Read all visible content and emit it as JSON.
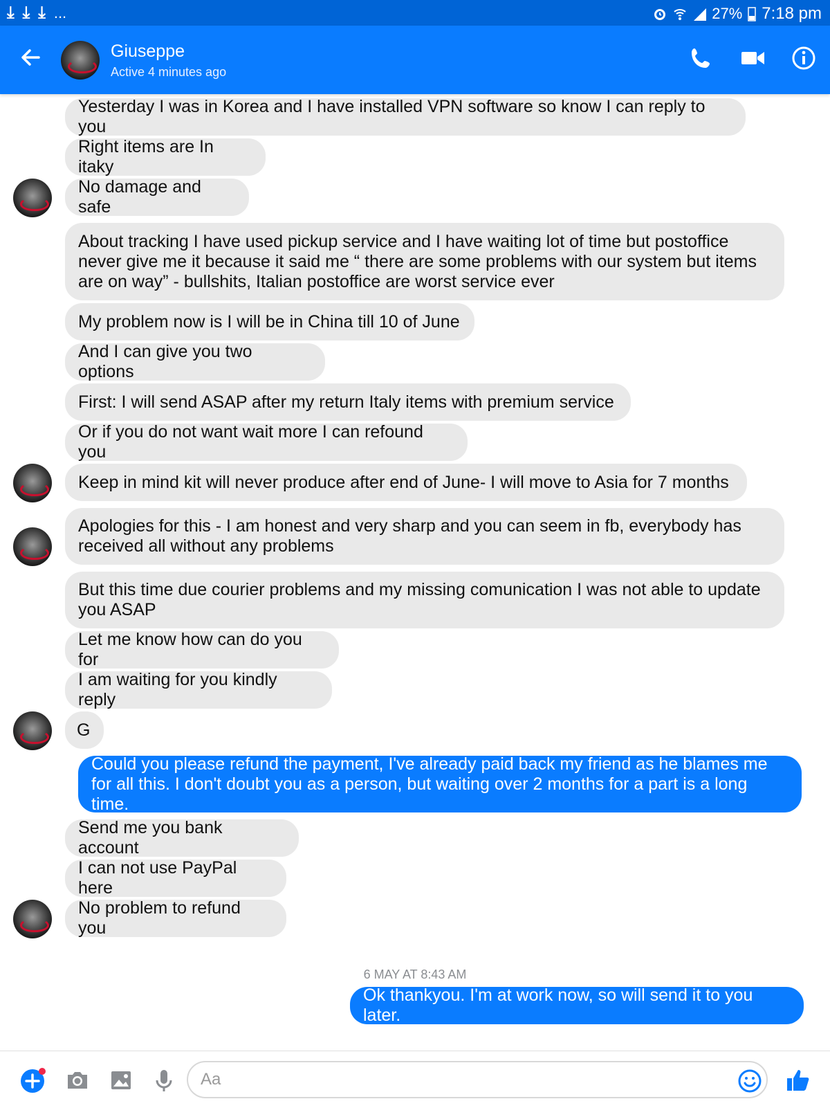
{
  "status_bar": {
    "download_icons": [
      "download-icon",
      "download-icon",
      "download-icon"
    ],
    "more": "...",
    "battery": "27%",
    "time": "7:18 pm"
  },
  "header": {
    "contact_name": "Giuseppe",
    "contact_status": "Active 4 minutes ago"
  },
  "messages": {
    "m1": "Yesterday I was in Korea and I have installed VPN software so know I can reply to you",
    "m2": "Right items are In itaky",
    "m3": "No damage and safe",
    "m4": "About tracking I have used pickup service and I have waiting lot of time but postoffice never give me it because it said me “ there are some problems with our system but items are on way” - bullshits, Italian postoffice are worst service ever",
    "m5": "My problem now is I will be in China till 10 of June",
    "m6": "And I can give you two options",
    "m7": "First: I will send ASAP after my return Italy items with premium service",
    "m8": "Or if you do not want wait more I can refound you",
    "m9": "Keep in mind kit will never produce after end of June- I will move to Asia for 7 months",
    "m10": "Apologies for this - I am honest and very sharp and you can seem in fb, everybody has received all without any problems",
    "m11": "But this time due courier problems and my missing comunication I was not able to update you ASAP",
    "m12": "Let me know how can do you for",
    "m13": "I am waiting for you kindly reply",
    "m14": "G",
    "m15": "Could you please refund the payment, I've already paid back my friend as he blames me for all this. I don't doubt you as a person, but waiting over 2 months for a part is a long time.",
    "m16": "Send me you bank account",
    "m17": "I can not use PayPal here",
    "m18": "No problem to refund you",
    "timestamp": "6 MAY AT 8:43 AM",
    "m19": "Ok thankyou. I'm at work now, so will send it to you later."
  },
  "composer": {
    "placeholder": "Aa"
  },
  "colors": {
    "status_bar": "#0064d6",
    "header": "#0a7cff",
    "incoming_bubble": "#e9e9e9",
    "outgoing_bubble": "#0a7cff",
    "notification_dot": "#f02849"
  }
}
